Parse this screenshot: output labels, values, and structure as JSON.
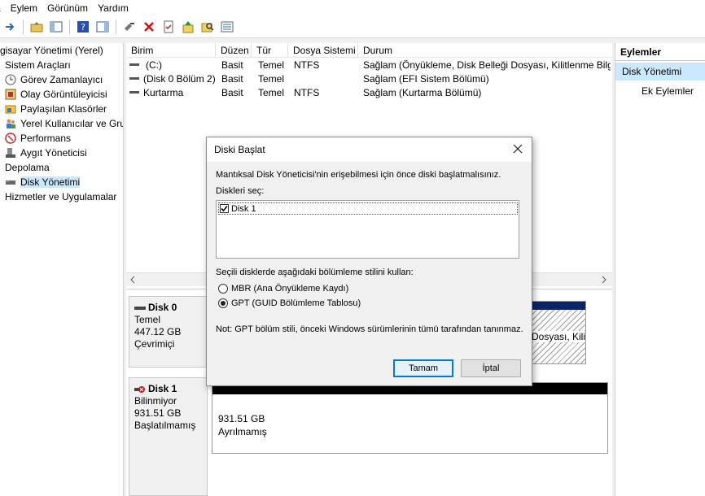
{
  "menu": [
    "a",
    "Eylem",
    "Görünüm",
    "Yardım"
  ],
  "tree": {
    "items": [
      {
        "label": "gisayar Yönetimi (Yerel)",
        "icon": "none",
        "indent": 0
      },
      {
        "label": "Sistem Araçları",
        "icon": "none",
        "indent": 0
      },
      {
        "label": "Görev Zamanlayıcı",
        "icon": "clock-icon",
        "indent": 1
      },
      {
        "label": "Olay Görüntüleyicisi",
        "icon": "event-viewer-icon",
        "indent": 1
      },
      {
        "label": "Paylaşılan Klasörler",
        "icon": "shared-folder-icon",
        "indent": 1
      },
      {
        "label": "Yerel Kullanıcılar ve Gru",
        "icon": "users-icon",
        "indent": 1
      },
      {
        "label": "Performans",
        "icon": "performance-icon",
        "indent": 1
      },
      {
        "label": "Aygıt Yöneticisi",
        "icon": "device-manager-icon",
        "indent": 1
      },
      {
        "label": "Depolama",
        "icon": "none",
        "indent": 0
      },
      {
        "label": "Disk Yönetimi",
        "icon": "disk-icon",
        "indent": 1
      },
      {
        "label": "Hizmetler ve Uygulamalar",
        "icon": "none",
        "indent": 0
      }
    ]
  },
  "volumes": {
    "columns": [
      "Birim",
      "Düzen",
      "Tür",
      "Dosya Sistemi",
      "Durum"
    ],
    "rows": [
      {
        "birim": "(C:)",
        "duzen": "Basit",
        "tur": "Temel",
        "fs": "NTFS",
        "durum": "Sağlam (Önyükleme, Disk Belleği Dosyası, Kilitlenme Bilgis"
      },
      {
        "birim": "(Disk 0 Bölüm 2)",
        "duzen": "Basit",
        "tur": "Temel",
        "fs": "",
        "durum": "Sağlam (EFI Sistem Bölümü)"
      },
      {
        "birim": "Kurtarma",
        "duzen": "Basit",
        "tur": "Temel",
        "fs": "NTFS",
        "durum": "Sağlam (Kurtarma Bölümü)"
      }
    ]
  },
  "disks": [
    {
      "name": "Disk 0",
      "type": "Temel",
      "size": "447.12 GB",
      "status": "Çevrimiçi",
      "partition_tail": "Dosyası, Kili"
    },
    {
      "name": "Disk 1",
      "type": "Bilinmiyor",
      "size": "931.51 GB",
      "status": "Başlatılmamış",
      "partition_size": "931.51 GB",
      "partition_status": "Ayrılmamış"
    }
  ],
  "actions": {
    "title": "Eylemler",
    "selected": "Disk Yönetimi",
    "more": "Ek Eylemler"
  },
  "dialog": {
    "title": "Diski Başlat",
    "intro": "Mantıksal Disk Yöneticisi'nin erişebilmesi için önce diski başlatmalısınız.",
    "select_label": "Diskleri seç:",
    "disk_item": "Disk 1",
    "disk_checked": true,
    "style_label": "Seçili disklerde aşağıdaki bölümleme stilini kullan:",
    "mbr_label": "MBR (Ana Önyükleme Kaydı)",
    "gpt_label": "GPT (GUID Bölümleme Tablosu)",
    "selected_style": "GPT",
    "note": "Not: GPT bölüm stili, önceki Windows sürümlerinin tümü tarafından tanınmaz.",
    "ok_label": "Tamam",
    "cancel_label": "İptal"
  },
  "colors": {
    "accent": "#0078d7",
    "selection": "#cce8ff",
    "unallocated_bar": "#000000",
    "primary_bar": "#0a246a"
  }
}
